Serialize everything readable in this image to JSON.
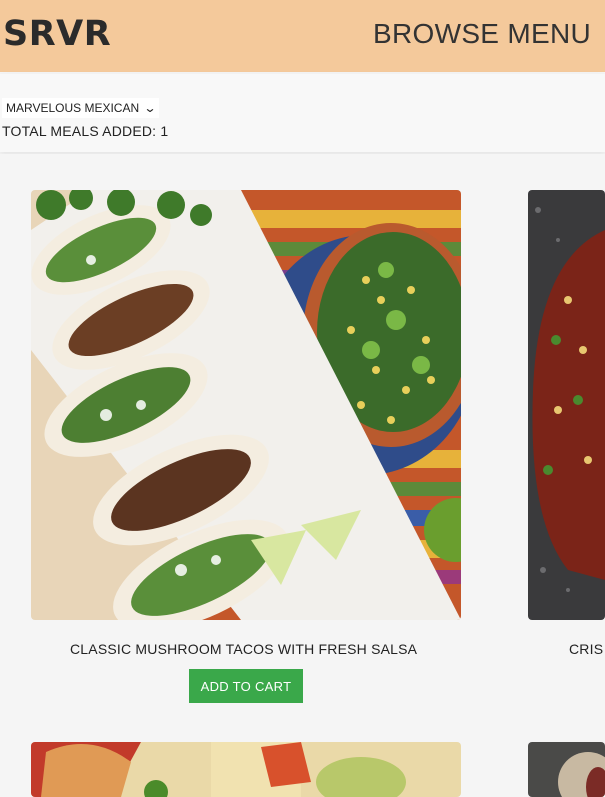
{
  "header": {
    "logo": "SRVR",
    "nav_label": "BROWSE MENU"
  },
  "controls": {
    "restaurant_select": "MARVELOUS MEXICAN",
    "total_meals": "TOTAL MEALS ADDED: 1"
  },
  "meals": [
    {
      "title": "CLASSIC MUSHROOM TACOS WITH FRESH SALSA",
      "button": "ADD TO CART"
    },
    {
      "title": "CRIS",
      "button": ""
    }
  ],
  "colors": {
    "header_bg": "#f4c99b",
    "button_bg": "#3aa84a",
    "page_bg": "#f5f5f5"
  }
}
